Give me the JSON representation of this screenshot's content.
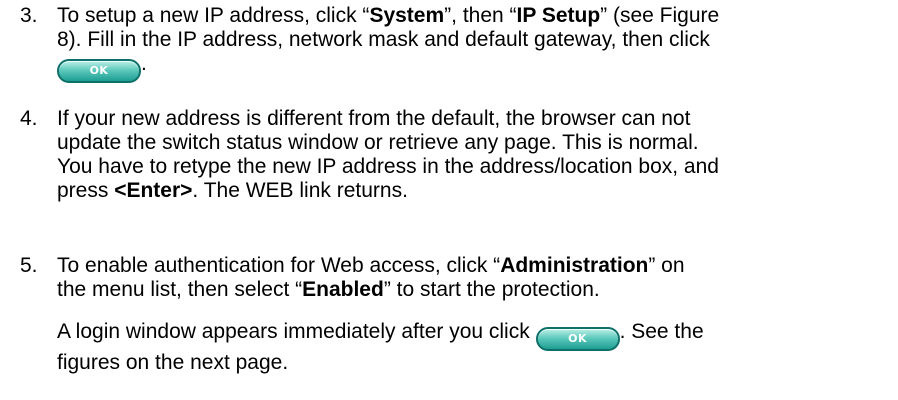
{
  "steps": [
    {
      "number": "3.",
      "line1": {
        "a": "To setup a new IP address, click “",
        "b1": "System",
        "c": "”, then “",
        "b2": "IP Setup",
        "d": "” (see Figure"
      },
      "line2": "8). Fill in the IP address, network mask and default gateway, then click",
      "line3_after_button": "."
    },
    {
      "number": "4.",
      "line1": "If your new address is different from the default, the browser can not",
      "line2": "update the switch status window or retrieve any page. This is normal.",
      "line3": "You have to retype the new IP address in the address/location box, and",
      "line4": {
        "a": "press ",
        "b": "<Enter>",
        "c": ". The WEB link returns."
      }
    },
    {
      "number": "5.",
      "line1": {
        "a": "To enable authentication for Web access, click “",
        "b": "Administration",
        "c": "” on"
      },
      "line2": {
        "a": "the menu list, then select “",
        "b": "Enabled",
        "c": "” to start the protection."
      },
      "note_line1_before_button": "A login window appears immediately after you click ",
      "note_line1_after_button": ". See the",
      "note_line2": "figures on the next page."
    }
  ],
  "ok_button": {
    "label": "OK",
    "color": "#1e9e92"
  }
}
